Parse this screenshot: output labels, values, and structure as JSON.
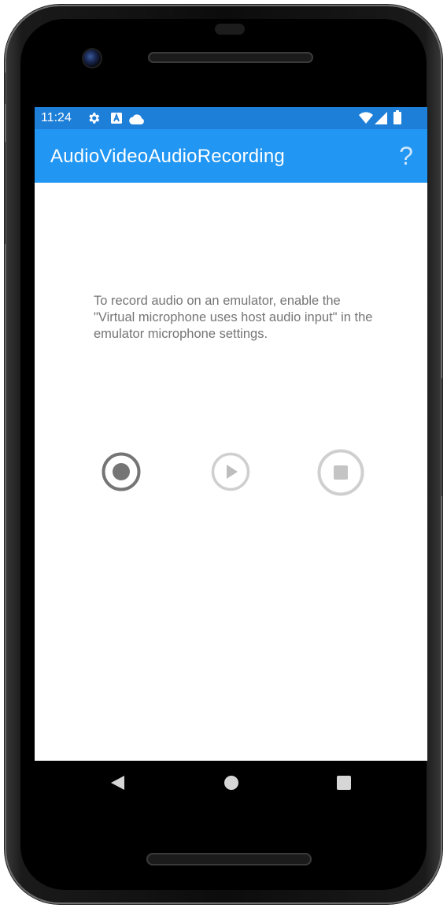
{
  "status_bar": {
    "time": "11:24",
    "background": "#1e7fd8",
    "icons": [
      "gear-icon",
      "notification-a-icon",
      "cloud-icon",
      "wifi-icon",
      "signal-icon",
      "battery-icon"
    ]
  },
  "app_bar": {
    "title": "AudioVideoAudioRecording",
    "help_label": "?",
    "background": "#2196f3"
  },
  "main": {
    "info_text": "To record audio on an emulator, enable the \"Virtual microphone uses host audio input\" in the emulator microphone settings."
  },
  "controls": [
    {
      "name": "record-button",
      "icon": "record-icon",
      "enabled": true
    },
    {
      "name": "play-button",
      "icon": "play-icon",
      "enabled": false
    },
    {
      "name": "stop-button",
      "icon": "stop-icon",
      "enabled": false
    }
  ],
  "nav_bar": {
    "icons": [
      "back-icon",
      "home-icon",
      "recents-icon"
    ]
  }
}
